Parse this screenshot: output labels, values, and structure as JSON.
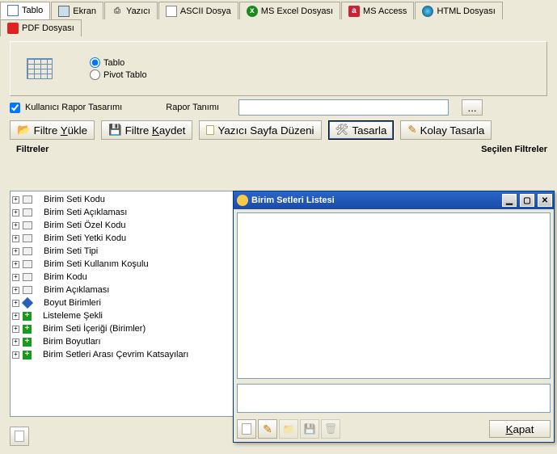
{
  "tabs": [
    {
      "label": "Tablo"
    },
    {
      "label": "Ekran"
    },
    {
      "label": "Yazıcı"
    },
    {
      "label": "ASCII Dosya"
    },
    {
      "label": "MS Excel Dosyası"
    },
    {
      "label": "MS Access"
    },
    {
      "label": "HTML Dosyası"
    },
    {
      "label": "PDF Dosyası"
    }
  ],
  "radio": {
    "tablo": "Tablo",
    "pivot": "Pivot Tablo"
  },
  "kul_checkbox": "Kullanıcı Rapor Tasarımı",
  "rapor_label": "Rapor Tanımı",
  "rapor_value": "",
  "toolbar": {
    "yukle": "Filtre Yükle",
    "kaydet": "Filtre Kaydet",
    "sayfa": "Yazıcı Sayfa Düzeni",
    "tasarla": "Tasarla",
    "kolay": "Kolay Tasarla"
  },
  "filtreler_label": "Filtreler",
  "secilen_label": "Seçilen Filtreler",
  "filters": [
    {
      "icon": "box",
      "label": "Birim Seti Kodu"
    },
    {
      "icon": "box",
      "label": "Birim Seti Açıklaması"
    },
    {
      "icon": "box",
      "label": "Birim Seti Özel Kodu"
    },
    {
      "icon": "box",
      "label": "Birim Seti Yetki Kodu"
    },
    {
      "icon": "box",
      "label": "Birim Seti Tipi"
    },
    {
      "icon": "box",
      "label": "Birim Seti Kullanım Koşulu"
    },
    {
      "icon": "box",
      "label": "Birim Kodu"
    },
    {
      "icon": "box",
      "label": "Birim Açıklaması"
    },
    {
      "icon": "diamond",
      "label": "Boyut Birimleri"
    },
    {
      "icon": "plus",
      "label": "Listeleme Şekli"
    },
    {
      "icon": "plus",
      "label": "Birim Seti İçeriği (Birimler)"
    },
    {
      "icon": "plus",
      "label": "Birim Boyutları"
    },
    {
      "icon": "plus",
      "label": "Birim Setleri Arası Çevrim Katsayıları"
    }
  ],
  "modal": {
    "title": "Birim Setleri Listesi",
    "kapat": "Kapat"
  }
}
